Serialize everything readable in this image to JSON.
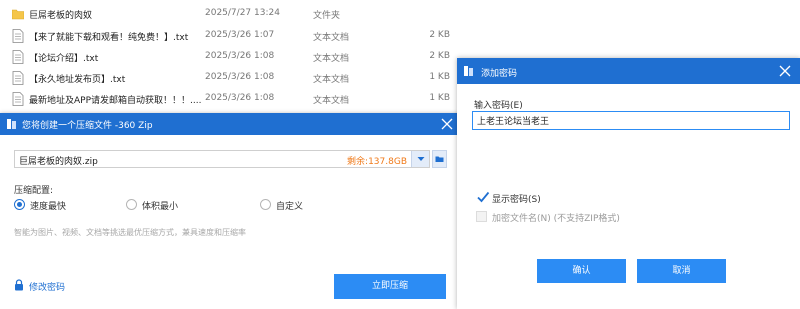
{
  "files": [
    {
      "icon": "folder-icon",
      "name": "巨屌老板的肉奴",
      "date": "2025/7/27 13:24",
      "type": "文件夹",
      "size": ""
    },
    {
      "icon": "text-file-icon",
      "name": "【来了就能下载和观看！纯免费！】.txt",
      "date": "2025/3/26 1:07",
      "type": "文本文档",
      "size": "2 KB"
    },
    {
      "icon": "text-file-icon",
      "name": "【论坛介绍】.txt",
      "date": "2025/3/26 1:08",
      "type": "文本文档",
      "size": "2 KB"
    },
    {
      "icon": "text-file-icon",
      "name": "【永久地址发布页】.txt",
      "date": "2025/3/26 1:08",
      "type": "文本文档",
      "size": "1 KB"
    },
    {
      "icon": "text-file-icon",
      "name": "最新地址及APP请发邮箱自动获取！！！....",
      "date": "2025/3/26 1:08",
      "type": "文本文档",
      "size": "1 KB"
    }
  ],
  "zip_dialog": {
    "title": "您将创建一个压缩文件 -360 Zip",
    "path": "巨屌老板的肉奴.zip",
    "remaining": "剩余:137.8GB",
    "config_label": "压缩配置:",
    "options": [
      {
        "label": "速度最快",
        "checked": true
      },
      {
        "label": "体积最小",
        "checked": false
      },
      {
        "label": "自定义",
        "checked": false
      }
    ],
    "hint": "智能为图片、视频、文档等挑选最优压缩方式，兼具速度和压缩率",
    "modify_password": "修改密码",
    "compress_button": "立即压缩"
  },
  "password_dialog": {
    "title": "添加密码",
    "input_label": "输入密码(E)",
    "input_value": "上老王论坛当老王",
    "show_password_label": "显示密码(S)",
    "show_password_checked": true,
    "encrypt_names_label": "加密文件名(N) (不支持ZIP格式)",
    "encrypt_names_checked": false,
    "confirm_label": "确认",
    "cancel_label": "取消"
  },
  "colors": {
    "accent": "#1f6fd1",
    "button": "#2c8cf4",
    "remaining": "#f07a1a"
  }
}
